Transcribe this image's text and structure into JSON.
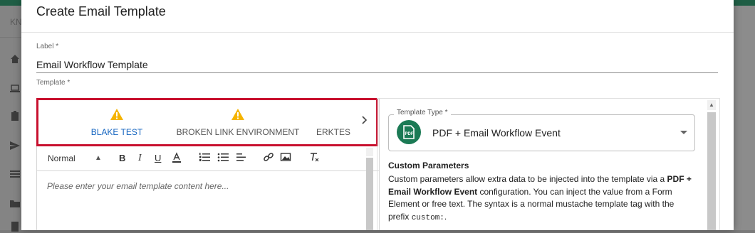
{
  "background": {
    "sidebar_text": "KN"
  },
  "dialog": {
    "title": "Create Email Template",
    "label_field": {
      "caption": "Label *",
      "value": "Email Workflow Template"
    },
    "template_caption": "Template *",
    "tabs": [
      {
        "label": "BLAKE TEST",
        "warning": true,
        "active": true
      },
      {
        "label": "BROKEN LINK ENVIRONMENT",
        "warning": true,
        "active": false
      },
      {
        "label": "ERKTEST",
        "warning": false,
        "active": false
      }
    ],
    "toolbar": {
      "format_select": "Normal"
    },
    "editor": {
      "placeholder": "Please enter your email template content here..."
    },
    "template_type": {
      "legend": "Template Type *",
      "value": "PDF + Email Workflow Event",
      "avatar_icon": "pdf-file-icon"
    },
    "custom_parameters": {
      "title": "Custom Parameters",
      "text_1": "Custom parameters allow extra data to be injected into the template via a ",
      "text_bold": "PDF + Email Workflow Event",
      "text_2": " configuration. You can inject the value from a Form Element or free text. The syntax is a normal mustache template tag with the prefix ",
      "code": "custom:",
      "text_3": "."
    }
  },
  "colors": {
    "accent": "#1b7a55",
    "tab_active": "#1565c0",
    "highlight": "#c8102e",
    "warning": "#f5b400"
  }
}
